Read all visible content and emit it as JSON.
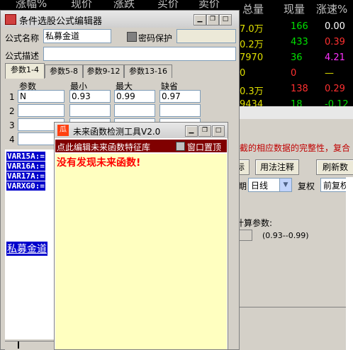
{
  "market": {
    "headers": [
      "涨幅%",
      "现价",
      "涨跌",
      "买价",
      "卖价",
      "总量",
      "现量",
      "涨速%"
    ],
    "rows": [
      {
        "total": "7.0万",
        "volume": "166",
        "speed": "0.00",
        "c1": "#e0e000",
        "c2": "#00e000",
        "c3": "#ffffff"
      },
      {
        "total": "0.2万",
        "volume": "433",
        "speed": "0.39",
        "c1": "#e0e000",
        "c2": "#00e000",
        "c3": "#ff3030"
      },
      {
        "total": "7970",
        "volume": "36",
        "speed": "4.21",
        "c1": "#e0e000",
        "c2": "#00e000",
        "c3": "#ff30ff"
      },
      {
        "total": "0",
        "volume": "0",
        "speed": "—",
        "c1": "#e0e000",
        "c2": "#ff3030",
        "c3": "#e0e000"
      },
      {
        "total": "0.3万",
        "volume": "138",
        "speed": "0.29",
        "c1": "#e0e000",
        "c2": "#ff3030",
        "c3": "#ff3030"
      },
      {
        "total": "9434",
        "volume": "18",
        "speed": "-0.12",
        "c1": "#e0e000",
        "c2": "#00e000",
        "c3": "#00e000"
      }
    ]
  },
  "bg_dialog": {
    "warning": "截的相应数据的完整性，复合",
    "usage_btn": "用法注释",
    "refresh_btn": "刷新数",
    "left_btn": "标",
    "period_prefix": "期",
    "period_value": "日线",
    "restore_label": "复权",
    "restore_value": "前复权",
    "calc_params": "计算参数:",
    "param_range": "(0.93--0.99)"
  },
  "editor": {
    "title": "条件选股公式编辑器",
    "name_label": "公式名称",
    "name_value": "私募金道",
    "password_label": "密码保护",
    "desc_label": "公式描述",
    "tabs": [
      "参数1-4",
      "参数5-8",
      "参数9-12",
      "参数13-16"
    ],
    "param_headers": [
      "参数",
      "最小",
      "最大",
      "缺省"
    ],
    "params": [
      {
        "idx": "1",
        "name": "N",
        "min": "0.93",
        "max": "0.99",
        "def": "0.97"
      },
      {
        "idx": "2",
        "name": "",
        "min": "",
        "max": "",
        "def": ""
      },
      {
        "idx": "3",
        "name": "",
        "min": "",
        "max": "",
        "def": ""
      },
      {
        "idx": "4",
        "name": "",
        "min": "",
        "max": "",
        "def": ""
      }
    ],
    "code_lines": [
      "VAR15A:=",
      "VAR16A:=",
      "VAR17A:=",
      "VARXG0:="
    ],
    "bottom_text": "私募金道"
  },
  "tool": {
    "title": "未来函数检测工具V2.0",
    "link": "点此编辑未来函数特征库",
    "pin_label": "窗口置顶",
    "result": "没有发现未来函数!"
  },
  "colors": {
    "code_bg": "#0000cc",
    "tool_bar": "#800000",
    "tool_content": "#ffffc0",
    "result_red": "#ff0000"
  }
}
